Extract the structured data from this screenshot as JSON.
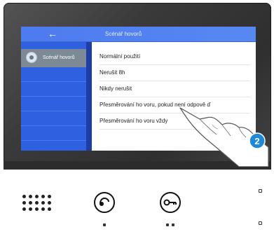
{
  "screen": {
    "back_icon": "←",
    "title": "Scénář hovorů",
    "sidebar": {
      "active_item_label": "Scénář hovorů",
      "active_item_icon": "call-scenario-icon"
    },
    "menu": {
      "items": [
        "Normální použití",
        "Nerušit 8h",
        "Nikdy nerušit",
        "Přesměrování ho voru, pokud není odpově ď",
        "Přesměrování ho voru vždy"
      ]
    }
  },
  "annotation": {
    "step_number": "2"
  },
  "colors": {
    "topbar": "#4d7bf0",
    "sidebar": "#2f60e0",
    "active_item": "#7d8a96",
    "step_badge": "#1e88d9"
  },
  "hardware": {
    "speaker_icon": "speaker-grille-icon",
    "talk_button_icon": "handset-icon",
    "unlock_button_icon": "key-icon"
  }
}
